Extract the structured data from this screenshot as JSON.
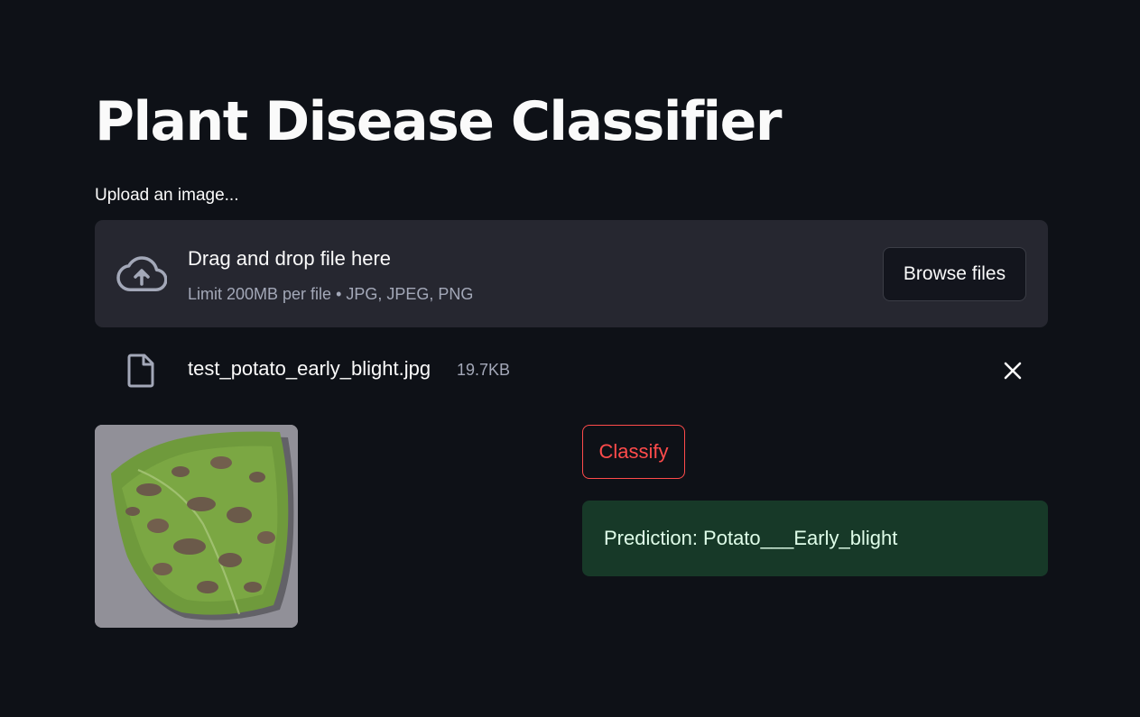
{
  "title": "Plant Disease Classifier",
  "uploader": {
    "label": "Upload an image...",
    "drop_text": "Drag and drop file here",
    "limit_text": "Limit 200MB per file • JPG, JPEG, PNG",
    "browse_label": "Browse files",
    "icon": "cloud-upload-icon"
  },
  "uploaded_file": {
    "name": "test_potato_early_blight.jpg",
    "size": "19.7KB",
    "icon": "file-icon",
    "remove_icon": "close-icon"
  },
  "image": {
    "description": "photo of potato leaf with early blight lesions"
  },
  "classify_label": "Classify",
  "prediction": {
    "text": "Prediction: Potato___Early_blight"
  },
  "colors": {
    "background": "#0e1117",
    "dropzone": "#262730",
    "accent": "#ff4b4b",
    "success_bg": "#173928",
    "success_text": "#dffde9"
  }
}
